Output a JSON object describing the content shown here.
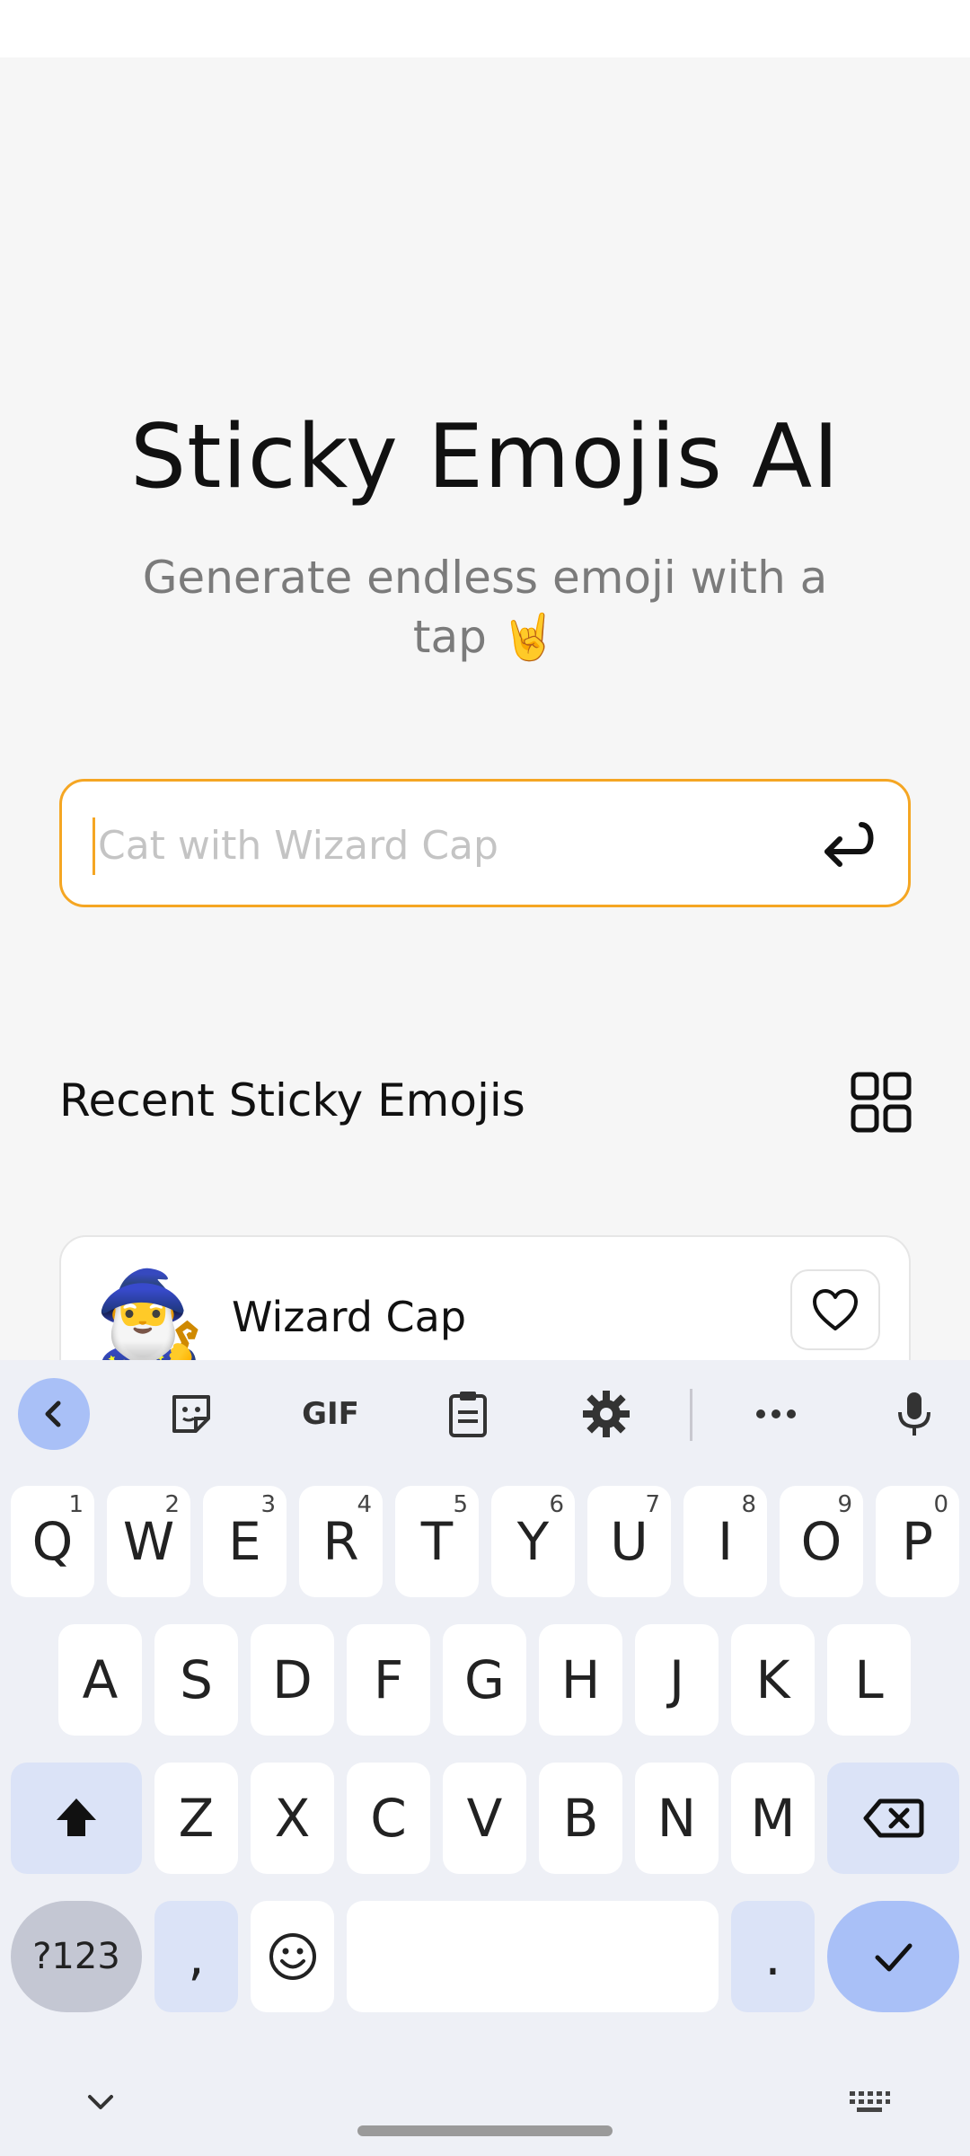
{
  "app": {
    "title": "Sticky Emojis AI",
    "subtitle": "Generate endless emoji with a tap 🤘",
    "search": {
      "placeholder": "Cat with Wizard Cap",
      "value": ""
    },
    "recent_title": "Recent Sticky Emojis",
    "recent_items": [
      {
        "emoji": "🧙‍♂️",
        "name": "Wizard Cap"
      }
    ],
    "accent_color": "#f5a623"
  },
  "keyboard": {
    "toolbar": {
      "gif_label": "GIF"
    },
    "row1": [
      {
        "k": "Q",
        "n": "1"
      },
      {
        "k": "W",
        "n": "2"
      },
      {
        "k": "E",
        "n": "3"
      },
      {
        "k": "R",
        "n": "4"
      },
      {
        "k": "T",
        "n": "5"
      },
      {
        "k": "Y",
        "n": "6"
      },
      {
        "k": "U",
        "n": "7"
      },
      {
        "k": "I",
        "n": "8"
      },
      {
        "k": "O",
        "n": "9"
      },
      {
        "k": "P",
        "n": "0"
      }
    ],
    "row2": [
      "A",
      "S",
      "D",
      "F",
      "G",
      "H",
      "J",
      "K",
      "L"
    ],
    "row3": [
      "Z",
      "X",
      "C",
      "V",
      "B",
      "N",
      "M"
    ],
    "symbols_label": "?123",
    "comma": ",",
    "period": ".",
    "accent_color": "#a9c0f7"
  }
}
